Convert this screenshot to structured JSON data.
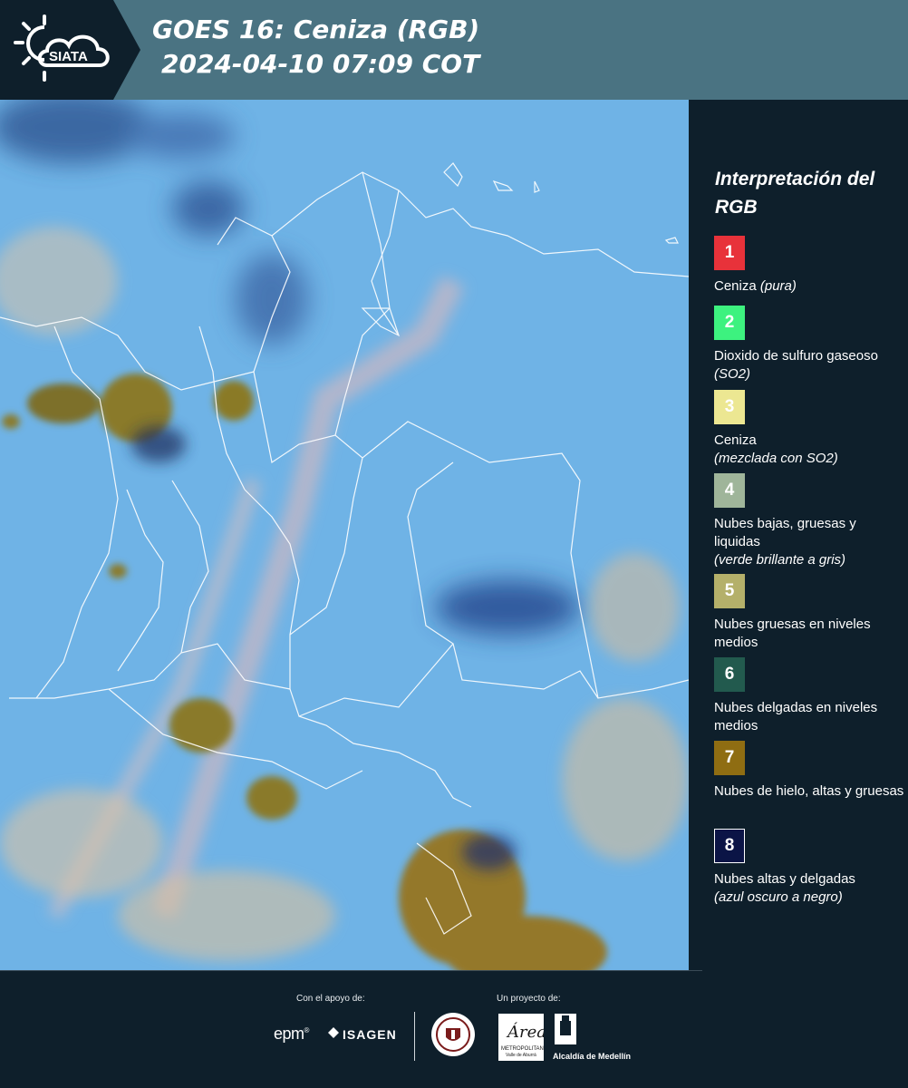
{
  "header": {
    "brand": "SIATA",
    "title_line1": "GOES 16: Ceniza (RGB)",
    "title_line2": "2024-04-10 07:09 COT"
  },
  "legend": {
    "title": "Interpretación del RGB",
    "items": [
      {
        "number": "1",
        "color": "#e8323a",
        "label": "Ceniza",
        "desc": "(pura)"
      },
      {
        "number": "2",
        "color": "#3df27f",
        "label": "Dioxido de sulfuro gaseoso",
        "desc": "(SO2)"
      },
      {
        "number": "3",
        "color": "#ece792",
        "label": "Ceniza",
        "desc": "(mezclada con SO2)"
      },
      {
        "number": "4",
        "color": "#9fb59a",
        "label": "Nubes bajas, gruesas y liquidas",
        "desc": "(verde brillante a gris)"
      },
      {
        "number": "5",
        "color": "#b4b06a",
        "label": "Nubes gruesas en niveles medios",
        "desc": ""
      },
      {
        "number": "6",
        "color": "#225a4e",
        "label": "Nubes delgadas en niveles medios",
        "desc": ""
      },
      {
        "number": "7",
        "color": "#8f6d12",
        "label": "Nubes de hielo, altas y gruesas",
        "desc": ""
      },
      {
        "number": "8",
        "color": "#0b1446",
        "label": "Nubes altas y delgadas",
        "desc": "(azul oscuro a negro)"
      }
    ]
  },
  "footer": {
    "support_label": "Con el apoyo de:",
    "project_label": "Un proyecto de:",
    "sponsor_1": "epm",
    "sponsor_2": "ISAGEN",
    "partner_1_logo": "ANTIOQUIA",
    "partner_2_logo": "Área METROPOLITANA Valle de Aburrá",
    "partner_3": "Alcaldía de Medellín"
  }
}
